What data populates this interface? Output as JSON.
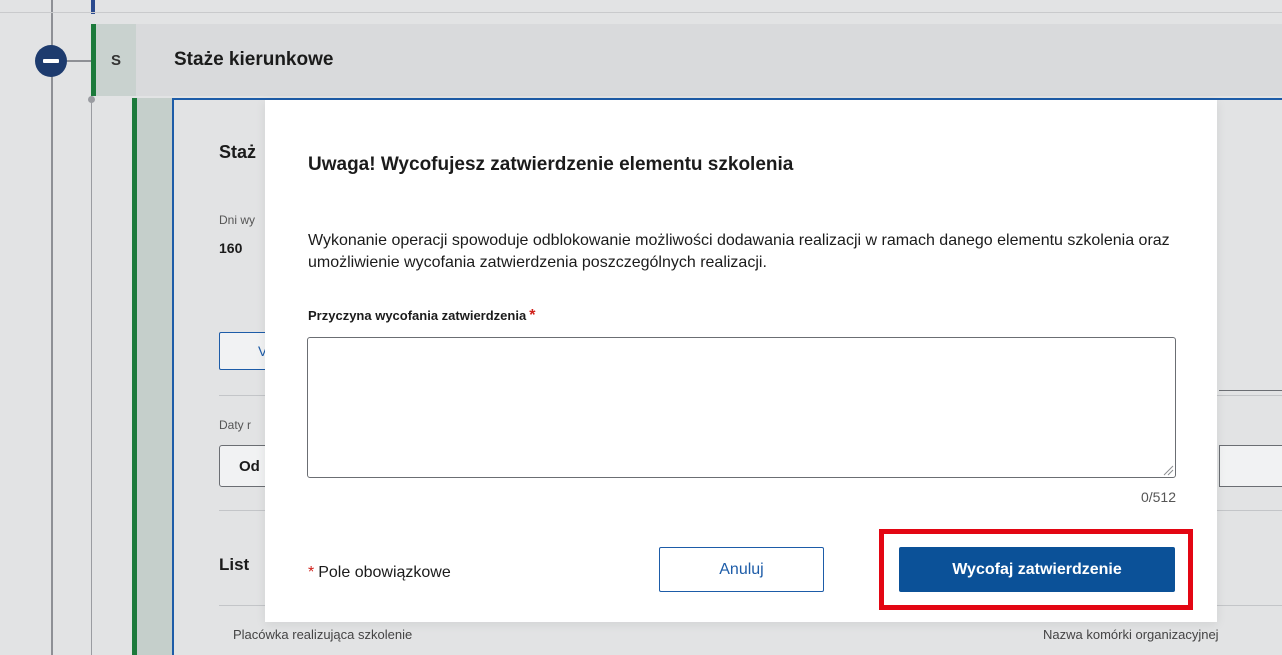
{
  "background": {
    "section_letter": "S",
    "section_title": "Staże kierunkowe",
    "card_title": "Staż",
    "days_label": "Dni wy",
    "days_value": "160",
    "card_button_label": "V",
    "dates_label": "Daty r",
    "dates_select_value": "Od",
    "list_title": "List",
    "column_1": "Placówka realizująca szkolenie",
    "column_2": "Nazwa komórki organizacyjnej"
  },
  "dialog": {
    "title": "Uwaga! Wycofujesz zatwierdzenie elementu szkolenia",
    "description": "Wykonanie operacji spowoduje odblokowanie możliwości dodawania realizacji w ramach danego elementu szkolenia oraz umożliwienie wycofania zatwierdzenia poszczególnych realizacji.",
    "reason_label": "Przyczyna wycofania zatwierdzenia",
    "reason_value": "",
    "char_counter": "0/512",
    "required_note": "Pole obowiązkowe",
    "cancel_label": "Anuluj",
    "confirm_label": "Wycofaj zatwierdzenie"
  },
  "colors": {
    "primary": "#0b5198",
    "section_green": "#1c7a3b",
    "required_red": "#d0201a",
    "highlight_red": "#e30613"
  }
}
